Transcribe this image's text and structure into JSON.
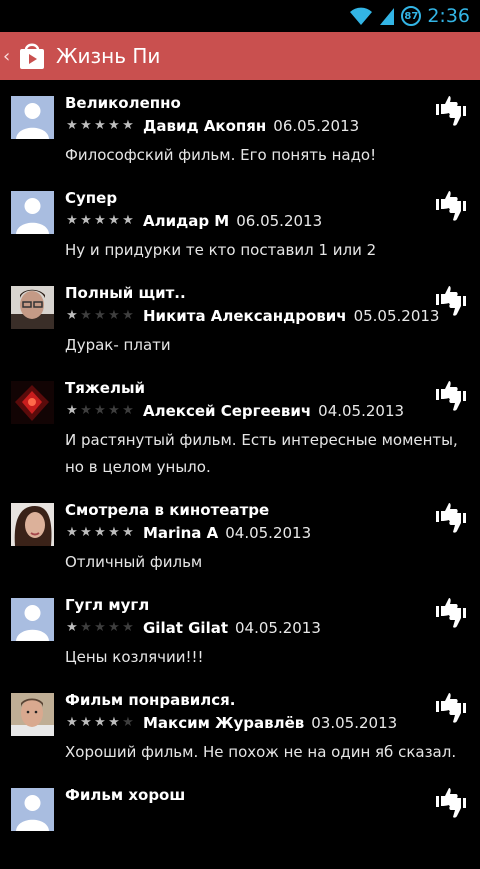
{
  "status": {
    "battery": "87",
    "time": "2:36"
  },
  "actionbar": {
    "title": "Жизнь Пи"
  },
  "reviews": [
    {
      "title": "Великолепно",
      "stars": 5,
      "author": "Давид Акопян",
      "date": "06.05.2013",
      "text": "Философский фильм. Его понять надо!",
      "avatar": "default-avatar"
    },
    {
      "title": "Супер",
      "stars": 5,
      "author": "Алидар М",
      "date": "06.05.2013",
      "text": "Ну и придурки те кто поставил 1 или 2",
      "avatar": "default-avatar"
    },
    {
      "title": "Полный щит..",
      "stars": 1,
      "author": "Никита Александрович",
      "date": "05.05.2013",
      "text": "Дурак- плати",
      "avatar": "photo-man-glasses"
    },
    {
      "title": "Тяжелый",
      "stars": 1,
      "author": "Алексей Сергеевич",
      "date": "04.05.2013",
      "text": "И растянутый фильм. Есть интересные моменты, но в целом уныло.",
      "avatar": "photo-red-lights"
    },
    {
      "title": "Смотрела в кинотеатре",
      "stars": 5,
      "author": "Marina A",
      "date": "04.05.2013",
      "text": "Отличный фильм",
      "avatar": "photo-woman"
    },
    {
      "title": "Гугл мугл",
      "stars": 1,
      "author": "Gilat Gilat",
      "date": "04.05.2013",
      "text": "Цены козлячии!!!",
      "avatar": "default-avatar"
    },
    {
      "title": "Фильм понравился.",
      "stars": 4,
      "author": "Максим Журавлёв",
      "date": "03.05.2013",
      "text": "Хороший фильм. Не похож не на один яб сказал.",
      "avatar": "photo-man"
    },
    {
      "title": "Фильм хорош",
      "stars": 5,
      "author": "",
      "date": "",
      "text": "",
      "avatar": "default-avatar"
    }
  ]
}
